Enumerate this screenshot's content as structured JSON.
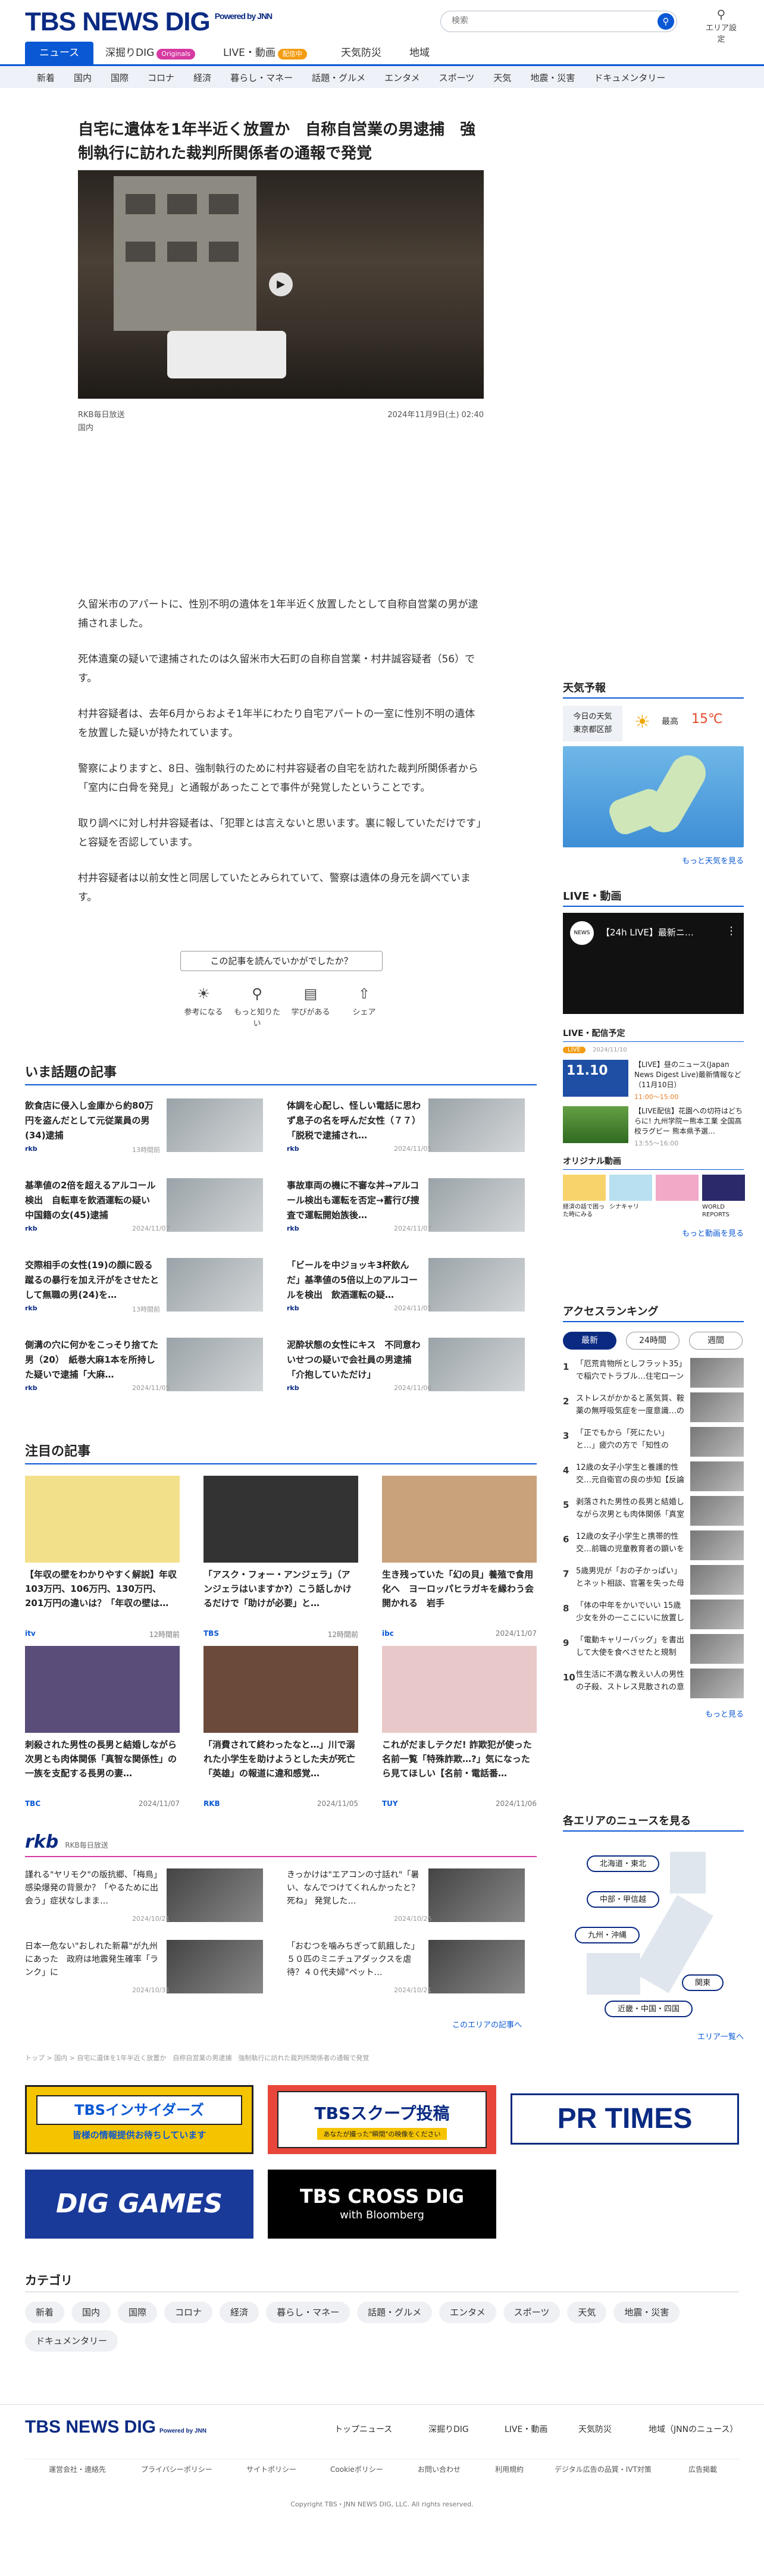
{
  "header": {
    "logo": "TBS NEWS DIG",
    "powered": "Powered by JNN",
    "search_placeholder": "検索",
    "search_icon": "magnifier",
    "area_label": "エリア設定",
    "area_icon": "location-pin"
  },
  "nav": {
    "items": [
      "ニュース",
      "深掘りDIG",
      "LIVE・動画",
      "天気防災",
      "地域"
    ],
    "dig_badge": "Originals",
    "live_badge": "配信中"
  },
  "subnav": [
    "新着",
    "国内",
    "国際",
    "コロナ",
    "経済",
    "暮らし・マネー",
    "話題・グルメ",
    "エンタメ",
    "スポーツ",
    "天気",
    "地震・災害",
    "ドキュメンタリー"
  ],
  "article": {
    "title": "自宅に遺体を1年半近く放置か　自称自営業の男逮捕　強制執行に訪れた裁判所関係者の通報で発覚",
    "source": "RKB毎日放送",
    "date": "2024年11月9日(土) 02:40",
    "category": "国内",
    "paragraphs": [
      "久留米市のアパートに、性別不明の遺体を1年半近く放置したとして自称自営業の男が逮捕されました。",
      "死体遺棄の疑いで逮捕されたのは久留米市大石町の自称自営業・村井誠容疑者（56）です。",
      "村井容疑者は、去年6月からおよそ1年半にわたり自宅アパートの一室に性別不明の遺体を放置した疑いが持たれています。",
      "警察によりますと、8日、強制執行のために村井容疑者の自宅を訪れた裁判所関係者から「室内に白骨を発見」と通報があったことで事件が発覚したということです。",
      "取り調べに対し村井容疑者は、「犯罪とは言えないと思います。裏に報していただけです」と容疑を否認しています。",
      "村井容疑者は以前女性と同居していたとみられていて、警察は遺体の身元を調べています。"
    ]
  },
  "reaction": {
    "question": "この記事を読んでいかがでしたか？",
    "buttons": [
      {
        "icon": "lightbulb",
        "label": "参考になる"
      },
      {
        "icon": "magnifier",
        "label": "もっと知りたい"
      },
      {
        "icon": "book",
        "label": "学びがある"
      },
      {
        "icon": "share",
        "label": "シェア"
      }
    ]
  },
  "trending": {
    "heading": "いま話題の記事",
    "items": [
      {
        "title": "飲食店に侵入し金庫から約80万円を盗んだとして元従業員の男(34)逮捕",
        "source": "rkb",
        "ago": "13時間前"
      },
      {
        "title": "体調を心配し、怪しい電話に思わず息子の名を呼んだ女性（７７）「脱税で逮捕され…",
        "source": "rkb",
        "ago": "2024/11/05"
      },
      {
        "title": "基準値の2倍を超えるアルコール検出　自転車を飲酒運転の疑い　中国籍の女(45)逮捕",
        "source": "rkb",
        "ago": "2024/11/07"
      },
      {
        "title": "事故車両の機に不審な丼→アルコール検出も運転を否定→蓄行び捜査で運転開始族後…",
        "source": "rkb",
        "ago": "2024/11/07"
      },
      {
        "title": "交際相手の女性(19)の顔に殴る蹴るの暴行を加え汗がをさせたとして無職の男(24)を…",
        "source": "rkb",
        "ago": "13時間前"
      },
      {
        "title": "「ビールを中ジョッキ3杯飲んだ」基準値の5倍以上のアルコールを検出　飲酒運転の疑…",
        "source": "rkb",
        "ago": "2024/11/05"
      },
      {
        "title": "側溝の穴に何かをこっそり捨てた男（20）　紙巻大麻1本を所持した疑いで逮捕「大麻…",
        "source": "rkb",
        "ago": "2024/11/05"
      },
      {
        "title": "泥酔状態の女性にキス　不同意わいせつの疑いで会社員の男逮捕「介抱していただけ」",
        "source": "rkb",
        "ago": "2024/11/06"
      }
    ]
  },
  "featured": {
    "heading": "注目の記事",
    "items": [
      {
        "title": "【年収の壁をわかりやすく解説】年収103万円、106万円、130万円、201万円の違いは？「年収の壁は…",
        "source": "itv",
        "date": "12時間前"
      },
      {
        "title": "「アスク・フォー・アンジェラ」（アンジェラはいますか?）こう話しかけるだけで「助けが必要」と…",
        "source": "TBS",
        "date": "12時間前"
      },
      {
        "title": "生き残っていた「幻の貝」養殖で食用化へ　ヨーロッパヒラガキを縁わう会開かれる　岩手",
        "source": "ibc",
        "date": "2024/11/07"
      },
      {
        "title": "刺殺された男性の長男と結婚しながら次男とも肉体関係「真智な関係性」の一族を支配する長男の妻…",
        "source": "TBC",
        "date": "2024/11/07"
      },
      {
        "title": "「消費されて終わったなと…」川で溺れた小学生を助けようとした夫が死亡「英雄」の報道に違和感覚…",
        "source": "RKB",
        "date": "2024/11/05"
      },
      {
        "title": "これがだましテクだ! 詐欺犯が使った名前一覧「特殊詐欺…?」気になったら見てほしい【名前・電話番…",
        "source": "TUY",
        "date": "2024/11/06"
      }
    ]
  },
  "rkb_section": {
    "heading": "RKB毎日放送",
    "more": "このエリアの記事へ",
    "items": [
      {
        "title": "謹れる\"ヤリモク\"の版抗郷、「梅鳥」感染爆発の背景か？「やるために出会う」症状なしまま…",
        "date": "2024/10/21"
      },
      {
        "title": "きっかけは\"エアコンの寸話れ\"「暑い、なんでつけてくれんかったと？　死ね」 発覚した…",
        "date": "2024/10/26"
      },
      {
        "title": "日本一危ない\"おしれた新幕\"が九州にあった　政府は地震発生確率「ランク」に",
        "date": "2024/10/31"
      },
      {
        "title": "「おむつを噛みちぎって飢餓した」５０匹のミニチュアダックスを虐待？４０代夫婦\"ペット…",
        "date": "2024/10/21"
      }
    ]
  },
  "breadcrumb": "トップ > 国内 > 自宅に遺体を1年半近く放置か　自称自営業の男逮捕　強制執行に訪れた裁判所関係者の通報で発覚",
  "banners": [
    "TBSインサイダーズ",
    "皆様の情報提供お待ちしています",
    "TBSスクープ投稿",
    "あなたが撮った\"瞬間\"の映像をください",
    "PR TIMES",
    "DIG GAMES",
    "TBS CROSS DIG",
    "with Bloomberg"
  ],
  "categories": {
    "heading": "カテゴリ",
    "items": [
      "新着",
      "国内",
      "国際",
      "コロナ",
      "経済",
      "暮らし・マネー",
      "話題・グルメ",
      "エンタメ",
      "スポーツ",
      "天気",
      "地震・災害",
      "ドキュメンタリー"
    ]
  },
  "footer": {
    "links": [
      "トップニュース",
      "深掘りDIG",
      "LIVE・動画",
      "天気防災",
      "地域（JNNのニュース）"
    ],
    "sub": [
      "運営会社・連絡先",
      "プライバシーポリシー",
      "サイトポリシー",
      "Cookieポリシー",
      "お問い合わせ",
      "利用規約",
      "デジタル広告の品質・IVT対策",
      "広告掲載"
    ],
    "copyright": "Copyright TBS・JNN NEWS DIG, LLC. All rights reserved."
  },
  "sidebar": {
    "weather": {
      "heading": "天気予報",
      "today": "今日の天気",
      "city": "東京都区部",
      "icon": "sun",
      "label": "最高",
      "temp": "15℃",
      "more": "もっと天気を見る"
    },
    "live": {
      "heading": "LIVE・動画",
      "title": "【24h LIVE】最新ニ…",
      "sched_heading": "LIVE・配信予定",
      "sched": [
        {
          "date": "2024/11/10",
          "text": "【LIVE】昼のニュース(Japan News Digest Live)最新情報など（11月10日）",
          "time": "11:00〜15:00"
        },
        {
          "date": "",
          "text": "【LIVE配信】花園への切符はどちらに! 九州学院ー熊本工業 全国高校ラグビー 熊本県予選…",
          "time": "13:55〜16:00"
        }
      ],
      "orig_heading": "オリジナル動画",
      "orig": [
        "経済の話で困った時にみる",
        "シナキャリ",
        "",
        "WORLD REPORTS"
      ],
      "more": "もっと動画を見る"
    },
    "ranking": {
      "heading": "アクセスランキング",
      "tabs": [
        "最新",
        "24時間",
        "週間"
      ],
      "items": [
        "「厄荒肯物所としフラット35」で稲穴でトラブル…住宅ローン4000万円「一括返済」求め…",
        "ストレスがかかると蒸気質、鞍薬の無呼吸気症を一度意識…の期待件厳　書個　事て人の表…",
        "「正でもから「死にたい」と…」疲穴の方で「知性の オ・ンーファン」強期、 訓勤早速…",
        "12歳の女子小学生と養護的性交…元自衛官の良の歩知【反論があれば対経しておいても対応…",
        "剥落された男性の長男と結婚しながら次男とも肉体関係「真室な関係性」の一族を支配…",
        "12歳の女子小学生と携帯的性交…前職の児童教育者の顕いを示…",
        "5歳男児が「おの子かっぱい」とネット相談、官署を失った母親刑事「苦い分を重ぎ…",
        "「体の中年をかいでいい 15歳少女を外の一ここにいに放置し保護された 高川県児…",
        "「電動キャリーバッグ」を書出して大使を食べさせたと規制が…",
        "性生活に不満な教えい人の男性の子殺、ストレス見散されの意決能暴…女性が日本に訴え…"
      ],
      "more": "もっと見る"
    },
    "areas": {
      "heading": "各エリアのニュースを見る",
      "items": [
        "北海道・東北",
        "中部・甲信越",
        "九州・沖縄",
        "関東",
        "近畿・中国・四国"
      ],
      "more": "エリア一覧へ"
    }
  }
}
